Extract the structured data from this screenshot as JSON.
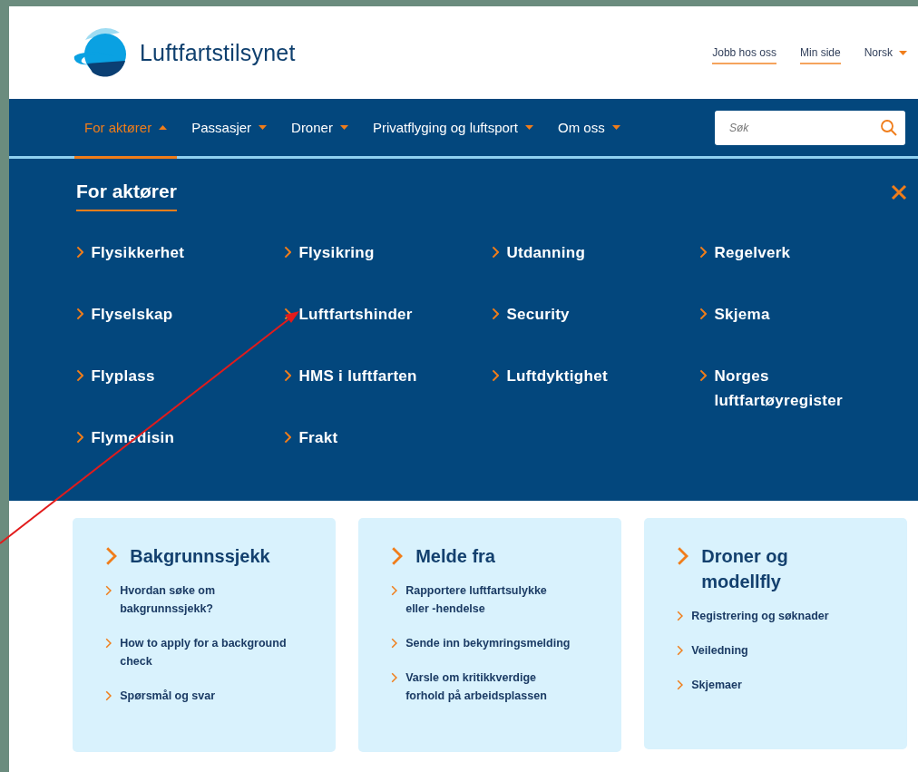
{
  "header": {
    "logo_text": "Luftfartstilsynet",
    "links": [
      {
        "label": "Jobb hos oss",
        "kind": "link"
      },
      {
        "label": "Min side",
        "kind": "link"
      },
      {
        "label": "Norsk",
        "kind": "dropdown"
      }
    ]
  },
  "nav": {
    "items": [
      {
        "label": "For aktører",
        "selected": true
      },
      {
        "label": "Passasjer",
        "selected": false
      },
      {
        "label": "Droner",
        "selected": false
      },
      {
        "label": "Privatflyging og luftsport",
        "selected": false
      },
      {
        "label": "Om oss",
        "selected": false
      }
    ],
    "search": {
      "placeholder": "Søk"
    }
  },
  "mega_menu": {
    "title": "For aktører",
    "items": [
      "Flysikkerhet",
      "Flysikring",
      "Utdanning",
      "Regelverk",
      "Flyselskap",
      "Luftfartshinder",
      "Security",
      "Skjema",
      "Flyplass",
      "HMS i luftfarten",
      "Luftdyktighet",
      "Norges luftfartøyregister",
      "Flymedisin",
      "Frakt"
    ]
  },
  "cards": [
    {
      "title": "Bakgrunnssjekk",
      "links": [
        "Hvordan søke om bakgrunnssjekk?",
        "How to apply for a background check",
        "Spørsmål og svar"
      ]
    },
    {
      "title": "Melde fra",
      "links": [
        "Rapportere luftfartsulykke eller -hendelse",
        "Sende inn bekymringsmelding",
        "Varsle om kritikkverdige forhold på arbeidsplassen"
      ]
    },
    {
      "title": "Droner og modellfly",
      "links": [
        "Registrering og søknader",
        "Veiledning",
        "Skjemaer"
      ]
    }
  ]
}
